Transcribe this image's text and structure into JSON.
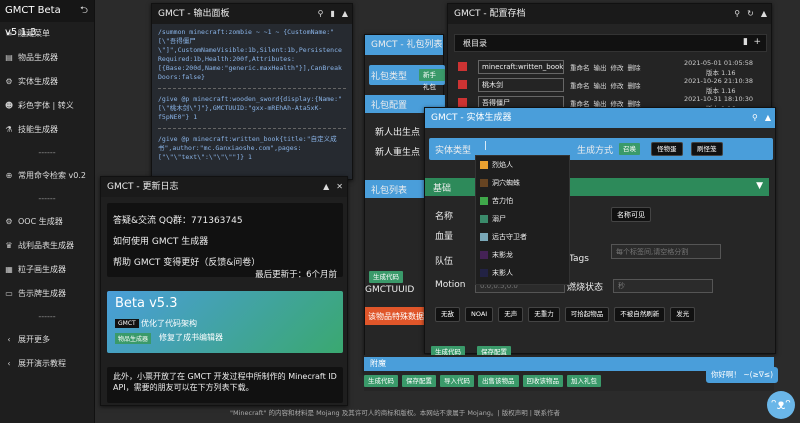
{
  "sidebar": {
    "title": "GMCT Beta v5.1.3",
    "items": [
      {
        "icon": "≡",
        "label": "隐藏菜单"
      },
      {
        "icon": "▤",
        "label": "物品生成器"
      },
      {
        "icon": "⚙",
        "label": "实体生成器"
      },
      {
        "icon": "☻",
        "label": "彩色字体 | 转义"
      },
      {
        "icon": "⚗",
        "label": "技能生成器"
      }
    ],
    "sep1": "------",
    "items2": [
      {
        "icon": "⊕",
        "label": "常用命令检索 v0.2"
      }
    ],
    "sep2": "------",
    "items3": [
      {
        "icon": "⚙",
        "label": "OOC 生成器"
      },
      {
        "icon": "♛",
        "label": "战利品表生成器"
      },
      {
        "icon": "▦",
        "label": "粒子画生成器"
      },
      {
        "icon": "▭",
        "label": "告示牌生成器"
      }
    ],
    "sep3": "------",
    "items4": [
      {
        "icon": "‹",
        "label": "展开更多"
      },
      {
        "icon": "‹",
        "label": "展开演示教程"
      }
    ]
  },
  "output": {
    "title": "GMCT - 输出面板",
    "cmd1": "/summon minecraft:zombie ~ ~1 ~ {CustomName:\"[\\\"吾得僵尸\\\"]\",CustomNameVisible:1b,Silent:1b,Persistence Required:1b,Health:200f,Attributes:[{Base:200d,Name:\"generic.maxHealth\"}],CanBreak Doors:false}",
    "cmd2": "/give @p minecraft:wooden_sword{display:{Name:\"[\\\"桃木剑\\\"]\"},GMCTUUID:\"gxx-mREhAh-Ata5xK-f5pNE0\"} 1",
    "cmd3": "/give @p minecraft:written_book{title:\"自定义成书\",author:\"mc.Ganxiaoshe.com\",pages:[\"\\\"\\\"text\\\":\\\"\\\"\\\"\"]} 1"
  },
  "changelog": {
    "title": "GMCT - 更新日志",
    "qq": "答疑&交流 QQ群：771363745",
    "use": "如何使用 GMCT 生成器",
    "help": "帮助 GMCT 变得更好（反馈&问卷）",
    "updated": "最后更新于：6个月前",
    "version": "Beta v5.3",
    "tag1": "GMCT",
    "note1": "优化了代码架构",
    "tag2": "物品生成器",
    "note2": "修复了成书编辑器",
    "footer": "此外，小票开放了在 GMCT 开发过程中所制作的 Minecraft ID API，需要的朋友可以在下方列表下载。"
  },
  "gift": {
    "title": "GMCT - 礼包列表",
    "type_label": "礼包类型",
    "type_btn": "新手礼包",
    "config": "礼包配置",
    "row1": "新人出生点",
    "row2": "新人重生点",
    "list": "礼包列表",
    "gen_code": "生成代码",
    "uuid": "GMCTUUID",
    "special": "该物品特殊数据"
  },
  "archive": {
    "title": "GMCT - 配置存档",
    "root": "根目录",
    "rows": [
      {
        "name": "minecraft:written_book",
        "date": "2021-05-01 01:05:58",
        "version": "版本 1.16"
      },
      {
        "name": "桃木剑",
        "date": "2021-10-26 21:10:38",
        "version": "版本 1.16"
      },
      {
        "name": "吾得僵尸",
        "date": "2021-10-31 18:10:30",
        "version": "版本 1.16"
      }
    ],
    "actions": [
      "重命名",
      "输出",
      "修改",
      "删除"
    ]
  },
  "entity": {
    "title": "GMCT - 实体生成器",
    "type_label": "实体类型",
    "gen_mode": "生成方式",
    "mode_buttons": [
      "召唤",
      "怪物蛋",
      "刷怪笼"
    ],
    "base": "基础",
    "name": "名称",
    "health": "血量",
    "team": "队伍",
    "tags": "Tags",
    "tags_placeholder": "每个标签间,请空格分割",
    "motion": "Motion",
    "motion_placeholder": "0.0,0.5,0.0",
    "burn": "燃烧状态",
    "burn_placeholder": "秒",
    "name_visible": "名称可见",
    "flags": [
      "无敌",
      "NOAI",
      "无声",
      "无重力",
      "可拾起物品",
      "不被自然刷新",
      "发光"
    ],
    "dropdown": [
      "烈焰人",
      "洞穴蜘蛛",
      "苦力怕",
      "溺尸",
      "远古守卫者",
      "末影龙",
      "末影人"
    ],
    "gen_code": "生成代码",
    "save": "保存配置"
  },
  "bottom": {
    "attach": "附魔",
    "buttons": [
      "生成代码",
      "保存配置",
      "导入代码",
      "出售该物品",
      "回收该物品",
      "加入礼包"
    ]
  },
  "footer_text": "\"Minecraft\" 的内容和材料是 Mojang 及其许可人的商标和版权。本网站不隶属于 Mojang。| 版权声明 | 联系作者",
  "chat_bubble": "你好啊！ ~(≥∇≤)",
  "colors": {
    "accent": "#4a9eda",
    "green": "#3a9a6a",
    "orange": "#e0562a"
  }
}
